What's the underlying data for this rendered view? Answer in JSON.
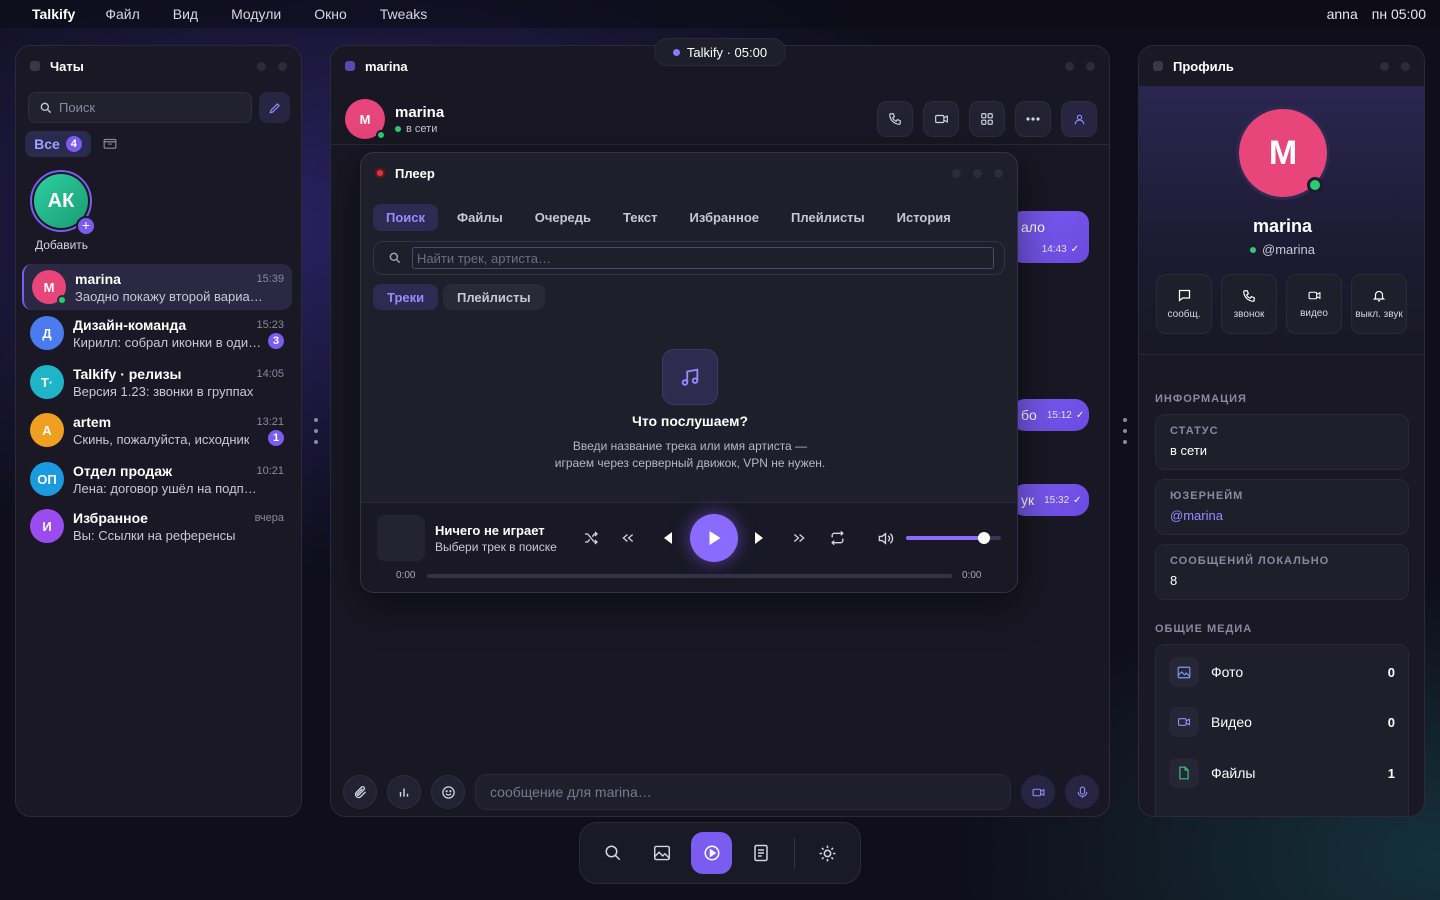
{
  "menubar": {
    "app": "Talkify",
    "items": [
      "Файл",
      "Вид",
      "Модули",
      "Окно",
      "Tweaks"
    ],
    "user": "anna",
    "clock": "пн 05:00"
  },
  "pill": {
    "text": "Talkify · 05:00"
  },
  "left": {
    "title": "Чаты",
    "search_placeholder": "Поиск",
    "filter_label": "Все",
    "filter_count": "4",
    "story_initials": "АК",
    "story_label": "Добавить",
    "chats": [
      {
        "initial": "M",
        "name": "marina",
        "time": "15:39",
        "preview": "Заодно покажу второй вариант …",
        "badge": "",
        "color": "#e8457a"
      },
      {
        "initial": "Д",
        "name": "Дизайн-команда",
        "time": "15:23",
        "preview": "Кирилл: собрал иконки в оди…",
        "badge": "3",
        "color": "#4a7cf0"
      },
      {
        "initial": "T·",
        "name": "Talkify · релизы",
        "time": "14:05",
        "preview": "Версия 1.23: звонки в группах",
        "badge": "",
        "color": "#1fb5c8"
      },
      {
        "initial": "A",
        "name": "artem",
        "time": "13:21",
        "preview": "Скинь, пожалуйста, исходник",
        "badge": "1",
        "color": "#f0a020"
      },
      {
        "initial": "ОП",
        "name": "Отдел продаж",
        "time": "10:21",
        "preview": "Лена: договор ушёл на подпись",
        "badge": "",
        "color": "#1a9be0"
      },
      {
        "initial": "И",
        "name": "Избранное",
        "time": "вчера",
        "preview": "Вы: Ссылки на референсы",
        "badge": "",
        "color": "#9b4cf0"
      }
    ]
  },
  "center": {
    "title": "marina",
    "contact": "marina",
    "status": "в сети",
    "initial": "M",
    "composer_placeholder": "сообщение для marina…",
    "bubbles": [
      {
        "text": "ало",
        "time": "14:43"
      },
      {
        "text": "бо",
        "time": "15:12"
      },
      {
        "text": "ук",
        "time": "15:32"
      }
    ]
  },
  "player": {
    "title": "Плеер",
    "tabs": [
      "Поиск",
      "Файлы",
      "Очередь",
      "Текст",
      "Избранное",
      "Плейлисты",
      "История"
    ],
    "search_placeholder": "Найти трек, артиста…",
    "subtabs": [
      "Треки",
      "Плейлисты"
    ],
    "empty_title": "Что послушаем?",
    "empty_line1": "Введи название трека или имя артиста —",
    "empty_line2": "играем через серверный движок, VPN не нужен.",
    "now_title": "Ничего не играет",
    "now_sub": "Выбери трек в поиске",
    "time_start": "0:00",
    "time_end": "0:00",
    "progress": 0,
    "volume": 0.82
  },
  "profile": {
    "title": "Профиль",
    "initial": "M",
    "name": "marina",
    "handle": "@marina",
    "actions": [
      "сообщ.",
      "звонок",
      "видео",
      "выкл. звук"
    ],
    "info_title": "ИНФОРМАЦИЯ",
    "info": [
      {
        "k": "СТАТУС",
        "v": "в сети"
      },
      {
        "k": "ЮЗЕРНЕЙМ",
        "v": "@marina"
      },
      {
        "k": "СООБЩЕНИЙ ЛОКАЛЬНО",
        "v": "8"
      }
    ],
    "media_title": "ОБЩИЕ МЕДИА",
    "media": [
      {
        "label": "Фото",
        "count": "0"
      },
      {
        "label": "Видео",
        "count": "0"
      },
      {
        "label": "Файлы",
        "count": "1"
      }
    ]
  },
  "colors": {
    "accent": "#7b5cf0",
    "online": "#2ecc71",
    "avatar_marina": "#e8457a"
  }
}
